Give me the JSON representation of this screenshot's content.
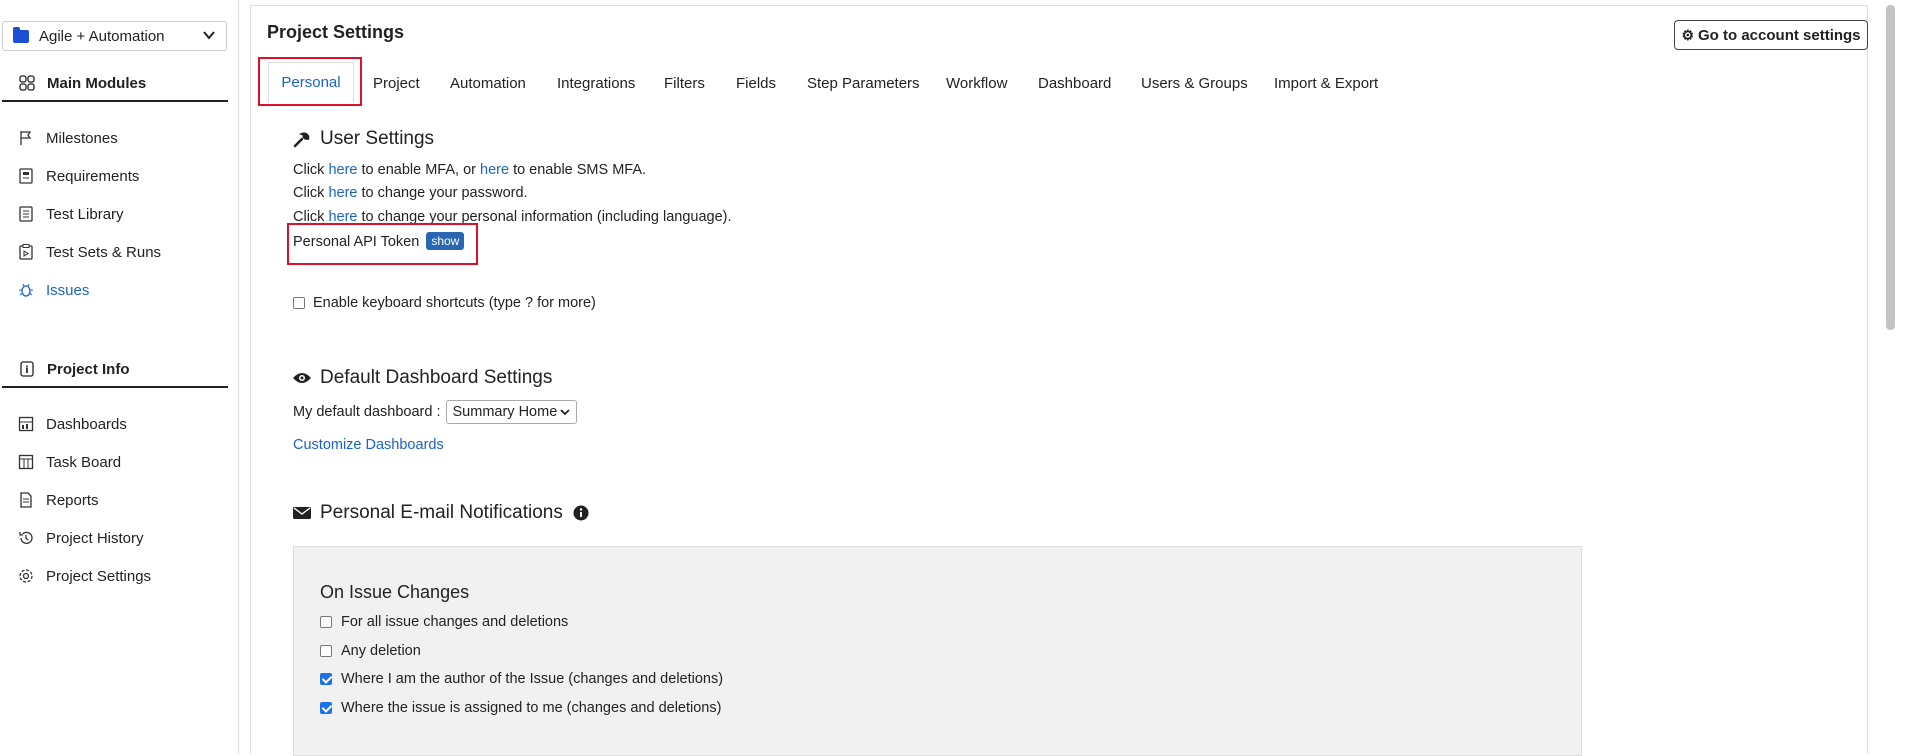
{
  "sidebar": {
    "project_selector": "Agile + Automation",
    "main_modules_label": "Main Modules",
    "main_items": [
      {
        "label": "Milestones",
        "icon": "flag-icon"
      },
      {
        "label": "Requirements",
        "icon": "requirements-icon"
      },
      {
        "label": "Test Library",
        "icon": "test-library-icon"
      },
      {
        "label": "Test Sets & Runs",
        "icon": "test-sets-icon"
      },
      {
        "label": "Issues",
        "icon": "bug-icon"
      }
    ],
    "project_info_label": "Project Info",
    "info_items": [
      {
        "label": "Dashboards",
        "icon": "dashboard-icon"
      },
      {
        "label": "Task Board",
        "icon": "task-board-icon"
      },
      {
        "label": "Reports",
        "icon": "reports-icon"
      },
      {
        "label": "Project History",
        "icon": "history-icon"
      },
      {
        "label": "Project Settings",
        "icon": "gear-icon"
      }
    ]
  },
  "header": {
    "title": "Project Settings",
    "account_button": "Go to account settings"
  },
  "tabs": [
    "Personal",
    "Project",
    "Automation",
    "Integrations",
    "Filters",
    "Fields",
    "Step Parameters",
    "Workflow",
    "Dashboard",
    "Users & Groups",
    "Import & Export"
  ],
  "user_settings": {
    "heading": "User Settings",
    "mfa": {
      "click": "Click",
      "here1": "here",
      "mid": "to enable MFA, or",
      "here2": "here",
      "end": "to enable SMS MFA."
    },
    "password": {
      "click": "Click",
      "here": "here",
      "end": "to change your password."
    },
    "personal": {
      "click": "Click",
      "here": "here",
      "end": "to change your personal information (including language)."
    },
    "api_token_label": "Personal API Token",
    "api_token_button": "show",
    "keyboard_shortcuts": "Enable keyboard shortcuts (type ? for more)"
  },
  "dashboard_settings": {
    "heading": "Default Dashboard Settings",
    "label": "My default dashboard :",
    "selected": "Summary Home",
    "customize_link": "Customize Dashboards"
  },
  "notifications": {
    "heading": "Personal E-mail Notifications",
    "panel_title": "On Issue Changes",
    "options": [
      {
        "label": "For all issue changes and deletions",
        "checked": false
      },
      {
        "label": "Any deletion",
        "checked": false
      },
      {
        "label": "Where I am the author of the Issue (changes and deletions)",
        "checked": true
      },
      {
        "label": "Where the issue is assigned to me (changes and deletions)",
        "checked": true
      }
    ]
  },
  "colors": {
    "accent": "#1a63c9",
    "highlight": "#e0102a",
    "button": "#2a67b3"
  }
}
